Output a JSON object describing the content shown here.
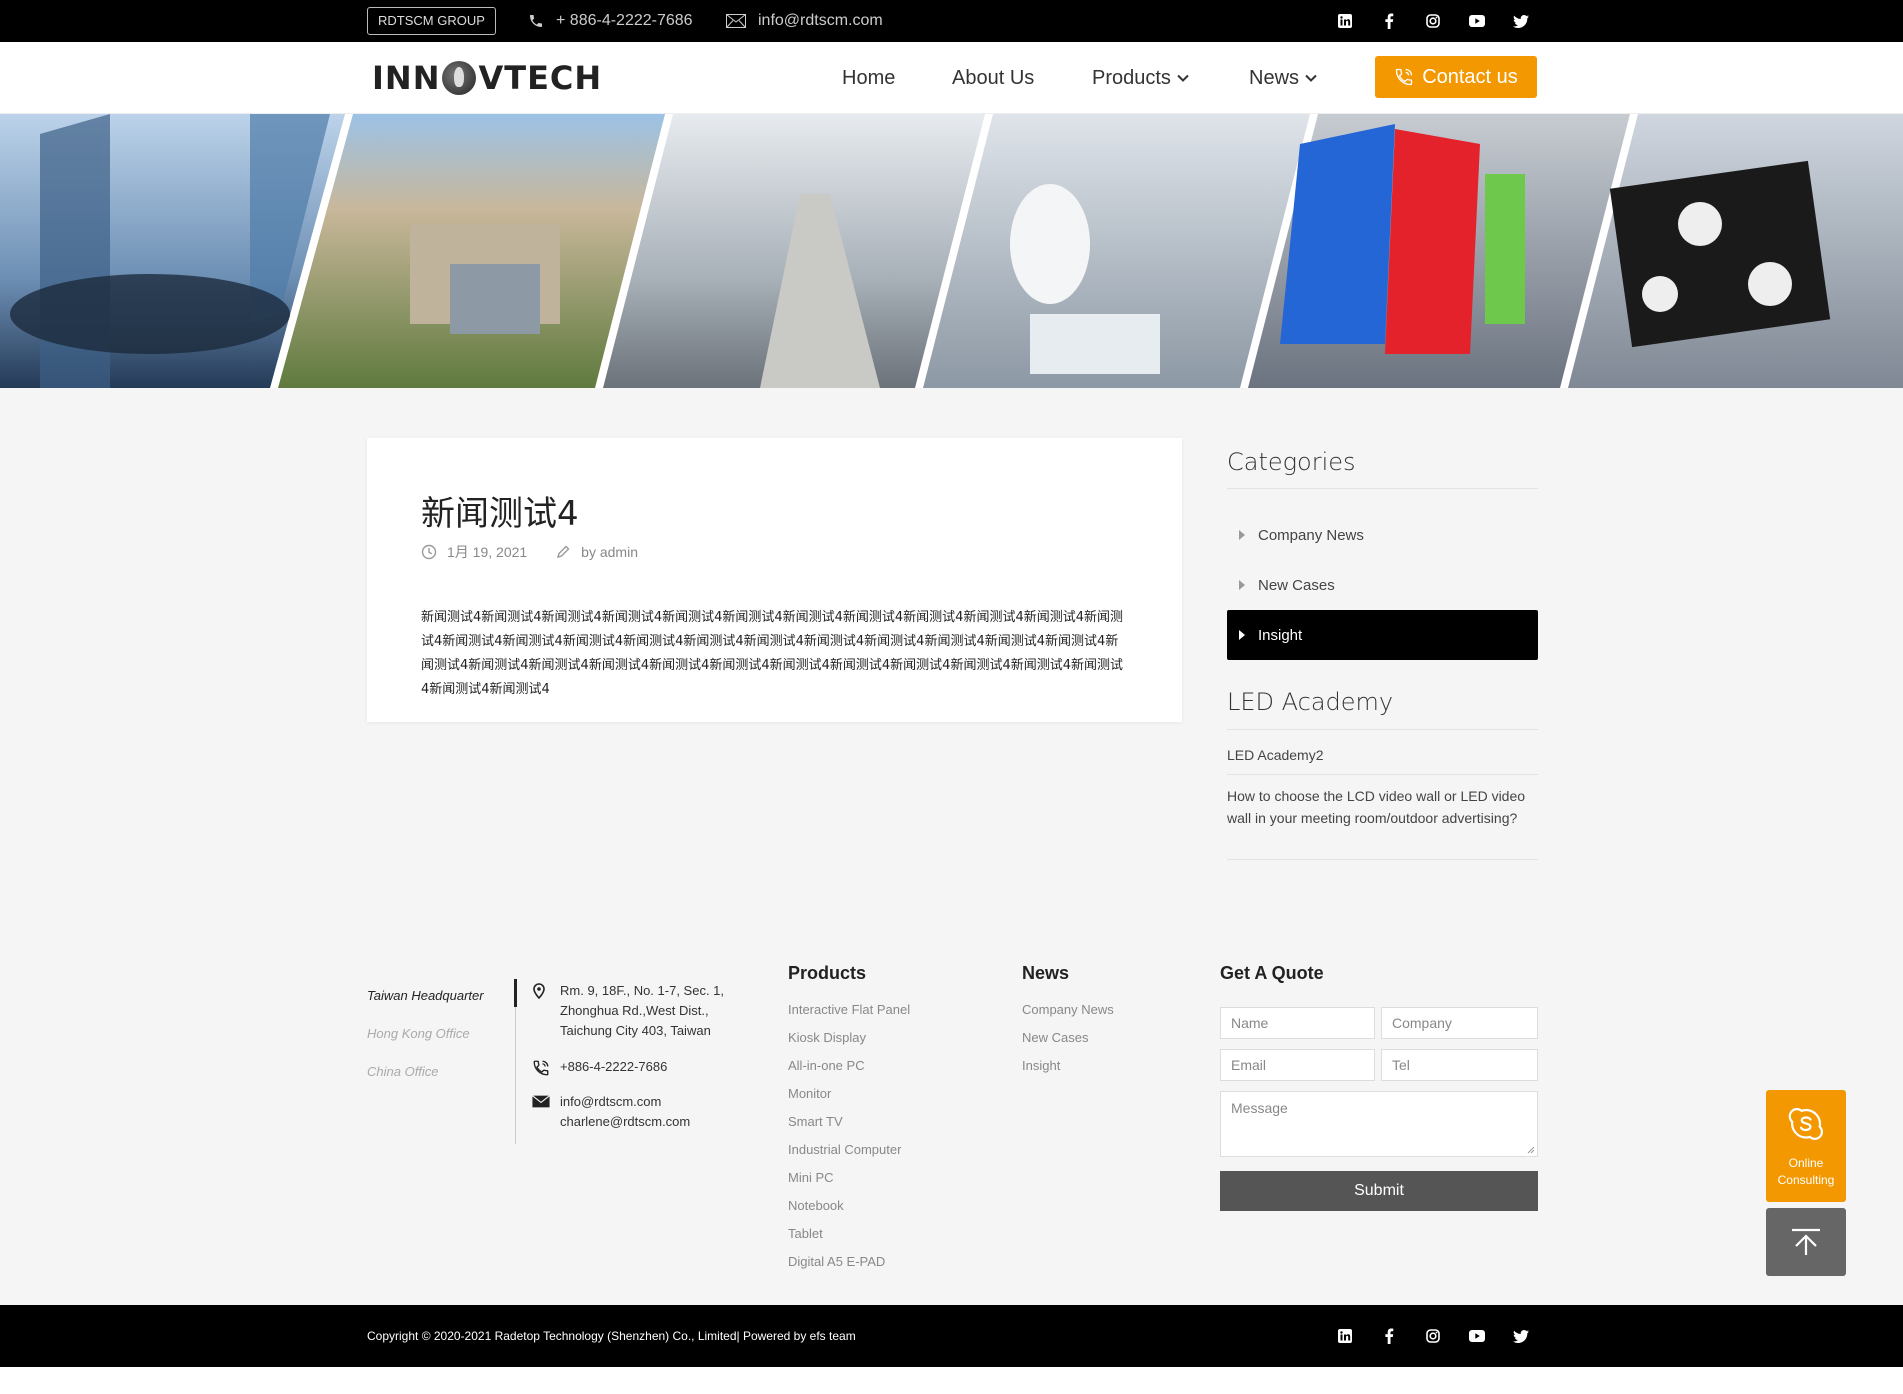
{
  "topbar": {
    "group_badge": "RDTSCM GROUP",
    "phone": "+ 886-4-2222-7686",
    "email": "info@rdtscm.com",
    "social_icons": [
      "linkedin-icon",
      "facebook-icon",
      "instagram-icon",
      "youtube-icon",
      "twitter-icon"
    ]
  },
  "header": {
    "logo_left": "INN",
    "logo_right": "VTECH",
    "nav": [
      {
        "label": "Home"
      },
      {
        "label": "About Us"
      },
      {
        "label": "Products"
      },
      {
        "label": "News"
      }
    ],
    "contact_button": "Contact us",
    "accent_color": "#f39800"
  },
  "article": {
    "title": "新闻测试4",
    "date": "1月 19, 2021",
    "author": "by admin",
    "body": "新闻测试4新闻测试4新闻测试4新闻测试4新闻测试4新闻测试4新闻测试4新闻测试4新闻测试4新闻测试4新闻测试4新闻测试4新闻测试4新闻测试4新闻测试4新闻测试4新闻测试4新闻测试4新闻测试4新闻测试4新闻测试4新闻测试4新闻测试4新闻测试4新闻测试4新闻测试4新闻测试4新闻测试4新闻测试4新闻测试4新闻测试4新闻测试4新闻测试4新闻测试4新闻测试4新闻测试4新闻测试4"
  },
  "sidebar": {
    "categories_title": "Categories",
    "categories": [
      {
        "label": "Company News"
      },
      {
        "label": "New Cases"
      },
      {
        "label": "Insight"
      }
    ],
    "academy_title": "LED Academy",
    "academy_items": [
      {
        "label": "LED Academy2"
      },
      {
        "label": "How to choose the LCD video wall or LED video wall in your meeting room/outdoor advertising?"
      }
    ]
  },
  "footer": {
    "offices": [
      "Taiwan Headquarter",
      "Hong Kong Office",
      "China Office"
    ],
    "address": "Rm. 9, 18F., No. 1-7, Sec. 1, Zhonghua Rd.,West Dist., Taichung City 403, Taiwan",
    "phone": "+886-4-2222-7686",
    "email1": "info@rdtscm.com",
    "email2": "charlene@rdtscm.com",
    "products_title": "Products",
    "products": [
      "Interactive Flat Panel",
      "Kiosk Display",
      "All-in-one PC",
      "Monitor",
      "Smart TV",
      "Industrial Computer",
      "Mini PC",
      "Notebook",
      "Tablet",
      "Digital A5 E-PAD"
    ],
    "news_title": "News",
    "news": [
      "Company News",
      "New Cases",
      "Insight"
    ],
    "quote_title": "Get A Quote",
    "placeholders": {
      "name": "Name",
      "company": "Company",
      "email": "Email",
      "tel": "Tel",
      "message": "Message"
    },
    "submit": "Submit",
    "copyright": "Copyright © 2020-2021 Radetop Technology (Shenzhen) Co., Limited| Powered by efs team"
  },
  "floating": {
    "consult_line1": "Online",
    "consult_line2": "Consulting"
  }
}
